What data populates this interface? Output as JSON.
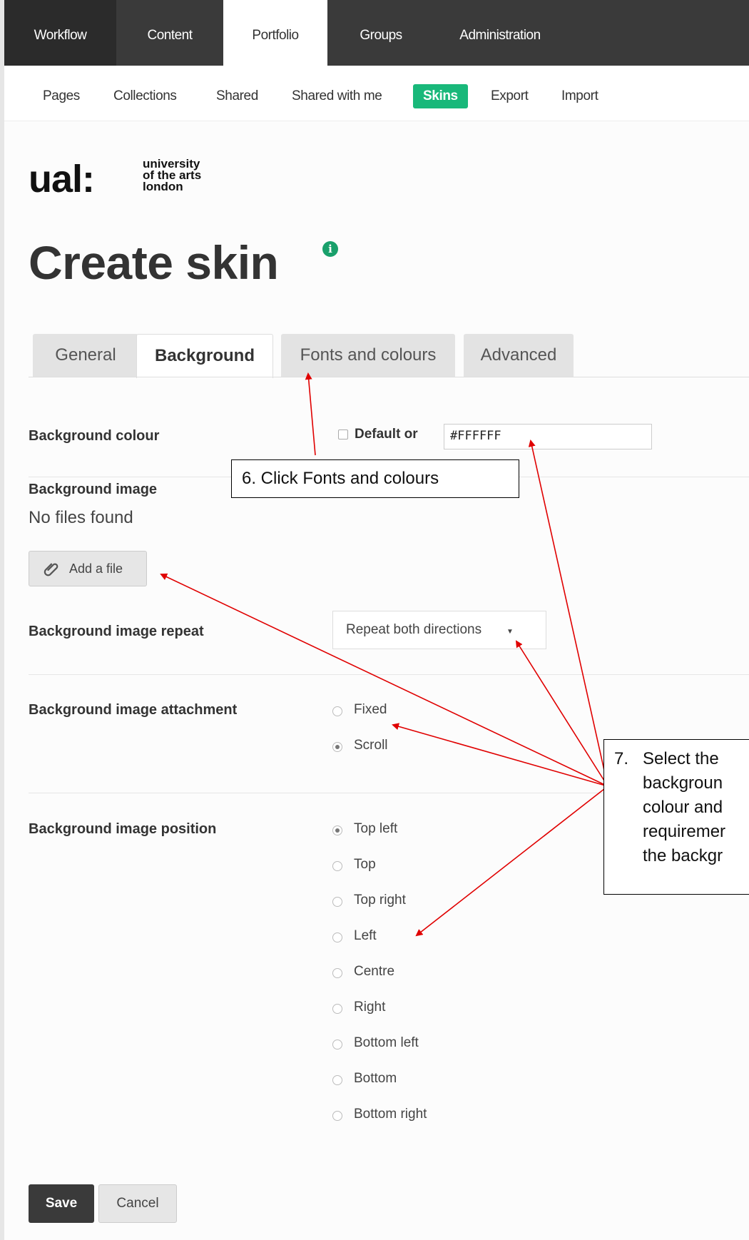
{
  "topnav": {
    "items": [
      "Workflow",
      "Content",
      "Portfolio",
      "Groups",
      "Administration"
    ]
  },
  "subnav": {
    "items": [
      "Pages",
      "Collections",
      "Shared",
      "Shared with me",
      "Skins",
      "Export",
      "Import"
    ]
  },
  "logo": {
    "main": "ual:",
    "sub": "university\nof the arts\nlondon"
  },
  "page": {
    "title": "Create skin",
    "info_icon": "i"
  },
  "tabs": [
    "General",
    "Background",
    "Fonts and colours",
    "Advanced"
  ],
  "form": {
    "bg_colour_label": "Background colour",
    "default_or": "Default or",
    "bg_colour_value": "#FFFFFF",
    "bg_image_label": "Background image",
    "no_files": "No files found",
    "add_file": "Add a file",
    "repeat_label": "Background image repeat",
    "repeat_value": "Repeat both directions",
    "attachment_label": "Background image attachment",
    "attachment_options": [
      "Fixed",
      "Scroll"
    ],
    "position_label": "Background image position",
    "position_options": [
      "Top left",
      "Top",
      "Top right",
      "Left",
      "Centre",
      "Right",
      "Bottom left",
      "Bottom",
      "Bottom right"
    ],
    "save": "Save",
    "cancel": "Cancel"
  },
  "callouts": {
    "step6": "6.   Click Fonts and colours",
    "step7": "7.   Select the\n      backgroun\n      colour and\n      requiremer\n      the backgr"
  },
  "colors": {
    "topnav_bg": "#3a3a3a",
    "active_skin": "#19b87a",
    "arrow": "#e00000"
  }
}
